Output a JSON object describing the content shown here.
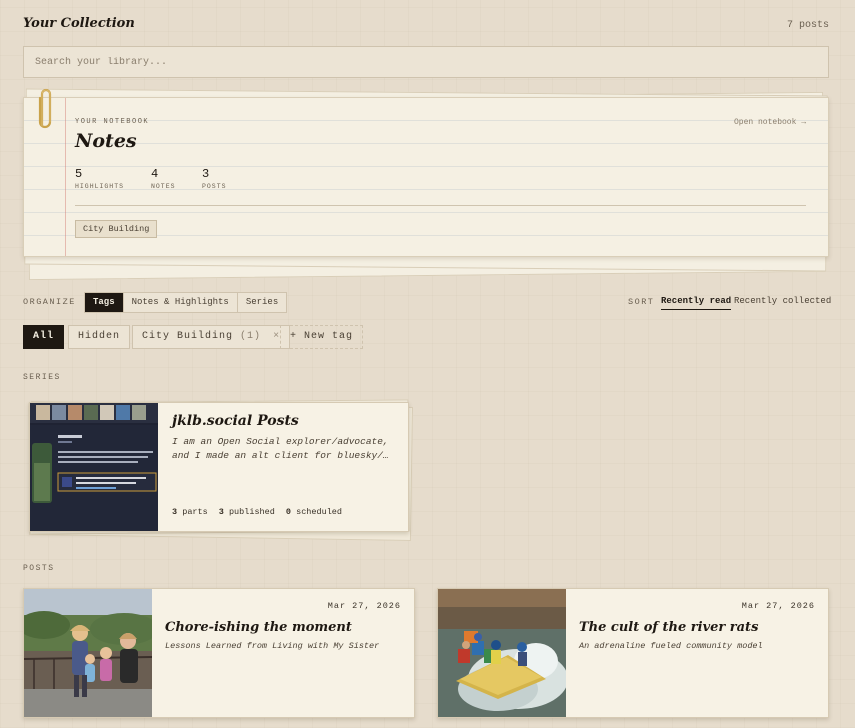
{
  "header": {
    "title": "Your Collection",
    "post_count": "7 posts"
  },
  "search": {
    "placeholder": "Search your library..."
  },
  "notebook": {
    "kicker": "YOUR NOTEBOOK",
    "open_label": "Open notebook →",
    "heading": "Notes",
    "stats": [
      {
        "value": "5",
        "label": "HIGHLIGHTS"
      },
      {
        "value": "4",
        "label": "NOTES"
      },
      {
        "value": "3",
        "label": "POSTS"
      }
    ],
    "tag": "City Building"
  },
  "organize": {
    "label": "ORGANIZE",
    "tabs": [
      "Tags",
      "Notes & Highlights",
      "Series"
    ],
    "active_tab": "Tags"
  },
  "sort": {
    "label": "SORT",
    "options": [
      "Recently read",
      "Recently collected"
    ],
    "active": "Recently read"
  },
  "tag_chips": {
    "all": "All",
    "hidden": "Hidden",
    "city_name": "City Building",
    "city_count": "(1)",
    "remove": "×",
    "new_tag": "+ New tag"
  },
  "series_section": {
    "label": "SERIES",
    "card": {
      "title": "jklb.social Posts",
      "desc_line1": "I am an Open Social explorer/advocate,",
      "desc_line2": "and I made an alt client for bluesky/…",
      "parts_num": "3",
      "parts_label": "parts",
      "published_num": "3",
      "published_label": "published",
      "scheduled_num": "0",
      "scheduled_label": "scheduled"
    }
  },
  "posts_section": {
    "label": "POSTS",
    "items": [
      {
        "date": "Mar 27, 2026",
        "title": "Chore-ishing the moment",
        "subtitle": "Lessons Learned from Living with My Sister"
      },
      {
        "date": "Mar 27, 2026",
        "title": "The cult of the river rats",
        "subtitle": "An adrenaline fueled community model"
      }
    ]
  },
  "colors": {
    "background": "#e6dccc",
    "paper": "#f7f2e5",
    "ink": "#1e1812",
    "accent_clip": "#c9a24a"
  }
}
